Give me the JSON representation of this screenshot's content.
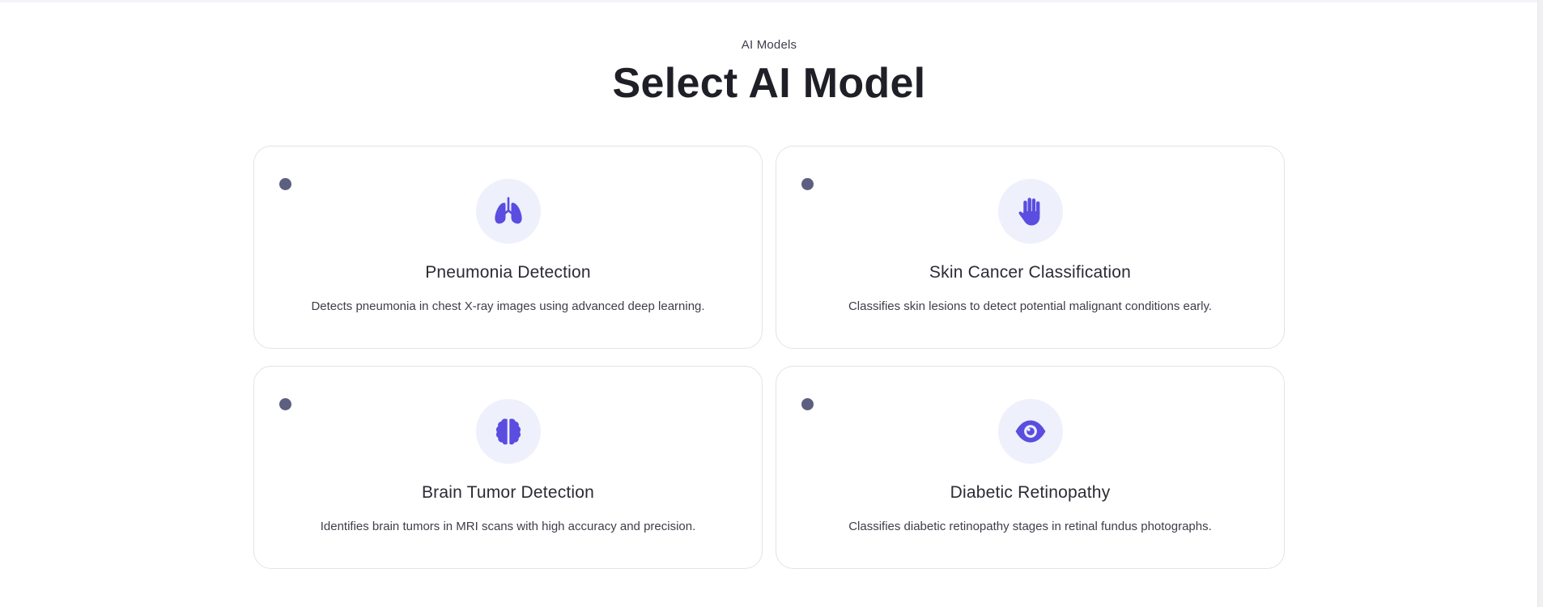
{
  "header": {
    "eyebrow": "AI Models",
    "title": "Select AI Model"
  },
  "colors": {
    "accent": "#5a4de0",
    "icon_bg": "#eef0fc",
    "radio": "#5d5f80",
    "border": "#e3e3ea"
  },
  "models": [
    {
      "title": "Pneumonia Detection",
      "description": "Detects pneumonia in chest X-ray images using advanced deep learning.",
      "icon": "lungs-icon"
    },
    {
      "title": "Skin Cancer Classification",
      "description": "Classifies skin lesions to detect potential malignant conditions early.",
      "icon": "hand-icon"
    },
    {
      "title": "Brain Tumor Detection",
      "description": "Identifies brain tumors in MRI scans with high accuracy and precision.",
      "icon": "brain-icon"
    },
    {
      "title": "Diabetic Retinopathy",
      "description": "Classifies diabetic retinopathy stages in retinal fundus photographs.",
      "icon": "eye-icon"
    }
  ]
}
